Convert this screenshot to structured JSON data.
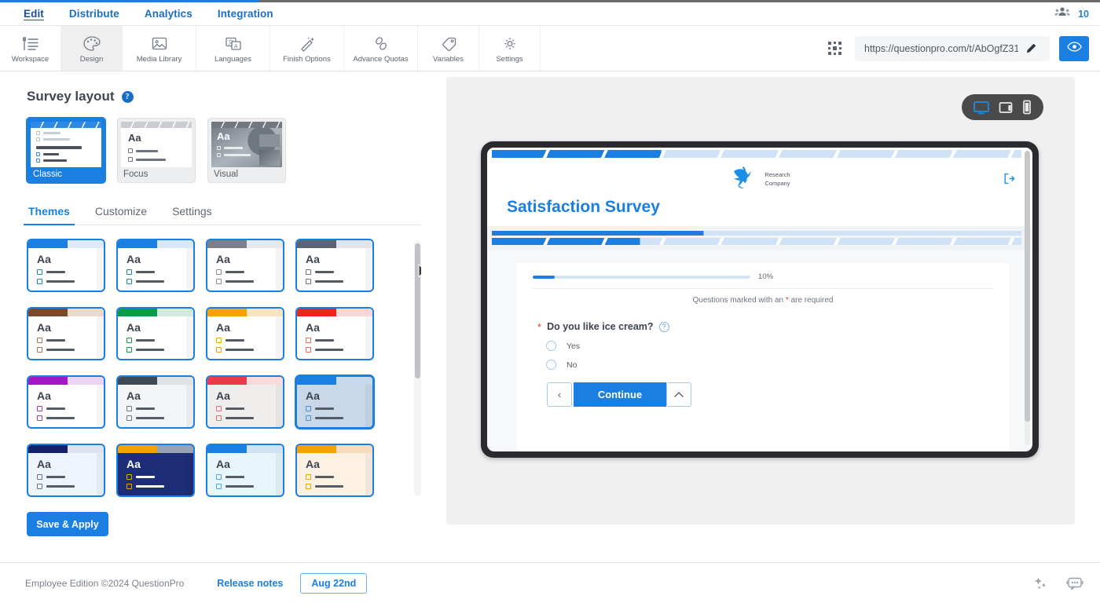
{
  "nav": {
    "items": [
      {
        "label": "Edit",
        "active": true
      },
      {
        "label": "Distribute",
        "active": false
      },
      {
        "label": "Analytics",
        "active": false
      },
      {
        "label": "Integration",
        "active": false
      }
    ],
    "member_count": "10",
    "people_icon": "people-group-icon"
  },
  "toolbar": {
    "items": [
      {
        "label": "Workspace",
        "icon": "workspace-list-icon",
        "active": false
      },
      {
        "label": "Design",
        "icon": "palette-icon",
        "active": true
      },
      {
        "label": "Media Library",
        "icon": "image-icon",
        "active": false
      },
      {
        "label": "Languages",
        "icon": "translate-icon",
        "active": false
      },
      {
        "label": "Finish Options",
        "icon": "magic-wand-icon",
        "active": false
      },
      {
        "label": "Advance Quotas",
        "icon": "link-chain-icon",
        "active": false
      },
      {
        "label": "Variables",
        "icon": "tag-icon",
        "active": false
      },
      {
        "label": "Settings",
        "icon": "gear-icon",
        "active": false
      }
    ],
    "qr_icon": "qr-code-icon",
    "survey_url": "https://questionpro.com/t/AbOgfZ31",
    "edit_icon": "pencil-icon",
    "preview_icon": "eye-icon"
  },
  "left_panel": {
    "title": "Survey layout",
    "help_icon": "question-mark-icon",
    "help_glyph": "?",
    "layouts": [
      {
        "label": "Classic",
        "selected": true
      },
      {
        "label": "Focus",
        "selected": false
      },
      {
        "label": "Visual",
        "selected": false
      }
    ],
    "tabs": [
      {
        "label": "Themes",
        "active": true
      },
      {
        "label": "Customize",
        "active": false
      },
      {
        "label": "Settings",
        "active": false
      }
    ],
    "aa_sample": "Aa",
    "themes": [
      {
        "stripe": "#1a7fe0",
        "stripe_light": "#dfeaf7",
        "accent": "#1a7fe0",
        "bg": "#ffffff",
        "text": "#3c444f",
        "selected": false
      },
      {
        "stripe": "#1a7fe0",
        "stripe_light": "#d8e8f8",
        "accent": "#1a7fe0",
        "bg": "#ffffff",
        "text": "#3c444f",
        "selected": false
      },
      {
        "stripe": "#7b7f86",
        "stripe_light": "#e7e8ea",
        "accent": "#8a9098",
        "bg": "#ffffff",
        "text": "#3c444f",
        "selected": false
      },
      {
        "stripe": "#5a6570",
        "stripe_light": "#e2e4e7",
        "accent": "#6d747d",
        "bg": "#ffffff",
        "text": "#3c444f",
        "selected": false
      },
      {
        "stripe": "#7a4a2e",
        "stripe_light": "#ead9cf",
        "accent": "#a07559",
        "bg": "#ffffff",
        "text": "#3c444f",
        "selected": false
      },
      {
        "stripe": "#0a9c4a",
        "stripe_light": "#d2ecdc",
        "accent": "#0a9c4a",
        "bg": "#ffffff",
        "text": "#3c444f",
        "selected": false
      },
      {
        "stripe": "#f5a100",
        "stripe_light": "#f8e3c6",
        "accent": "#f5a100",
        "bg": "#ffffff",
        "text": "#3c444f",
        "selected": false
      },
      {
        "stripe": "#e8251f",
        "stripe_light": "#f8d6d4",
        "accent": "#e8695f",
        "bg": "#ffffff",
        "text": "#3c444f",
        "selected": false
      },
      {
        "stripe": "#a117c4",
        "stripe_light": "#ecd2f3",
        "accent": "#b52fd6",
        "bg": "#ffffff",
        "text": "#3c444f",
        "selected": false
      },
      {
        "stripe": "#3e4b57",
        "stripe_light": "#e0e2e5",
        "accent": "#717983",
        "bg": "#f4f5f6",
        "text": "#3c444f",
        "selected": false
      },
      {
        "stripe": "#eb3a4a",
        "stripe_light": "#f9dadc",
        "accent": "#ef6a72",
        "bg": "#efeeec",
        "text": "#3c444f",
        "selected": false
      },
      {
        "stripe": "#1a7fe0",
        "stripe_light": "#c6d9ee",
        "accent": "#4d8fd0",
        "bg": "#c9d8e9",
        "text": "#3c444f",
        "selected": true
      },
      {
        "stripe": "#16216e",
        "stripe_light": "#dde2ee",
        "accent": "#6d747d",
        "bg": "#eef4fb",
        "text": "#3c444f",
        "selected": false
      },
      {
        "stripe": "#f5a100",
        "stripe_light": "#9aa3b5",
        "accent": "#f5a100",
        "bg": "#1e2d78",
        "text": "#ffffff",
        "selected": false
      },
      {
        "stripe": "#1a7fe0",
        "stripe_light": "#cfe3f5",
        "accent": "#4fa8e8",
        "bg": "#e7f6fb",
        "text": "#3c444f",
        "selected": false
      },
      {
        "stripe": "#f5a100",
        "stripe_light": "#f7dcbb",
        "accent": "#f5a100",
        "bg": "#fdf1e4",
        "text": "#3c444f",
        "selected": false
      }
    ],
    "save_label": "Save & Apply"
  },
  "preview": {
    "devices": [
      {
        "name": "desktop",
        "icon": "desktop-icon",
        "active": true
      },
      {
        "name": "tablet",
        "icon": "tablet-icon",
        "active": false
      },
      {
        "name": "mobile",
        "icon": "mobile-icon",
        "active": false
      }
    ],
    "brand_line1": "Research",
    "brand_line2": "Company",
    "logo_icon": "bird-logo-icon",
    "survey_title": "Satisfaction Survey",
    "logout_icon": "logout-icon",
    "progress_percent": "10%",
    "progress_value": 10,
    "required_prefix": "Questions marked with an ",
    "required_star": "*",
    "required_suffix": " are required",
    "question_text": "Do you like ice cream?",
    "question_help_glyph": "?",
    "options": [
      {
        "label": "Yes"
      },
      {
        "label": "No"
      }
    ],
    "prev_glyph": "‹",
    "continue_label": "Continue",
    "up_glyph": "⌃"
  },
  "footer": {
    "copyright": "Employee Edition ©2024 QuestionPro",
    "release_notes": "Release notes",
    "date_badge": "Aug 22nd",
    "sparkle_icon": "sparkles-icon",
    "chat_icon": "chat-bot-icon"
  },
  "colors": {
    "accent": "#1a7fe0",
    "nav_link": "#1b6ec2",
    "panel_bg": "#f0f0f0",
    "device_bezel": "#2b2b2f",
    "required_red": "#e03b3b"
  }
}
